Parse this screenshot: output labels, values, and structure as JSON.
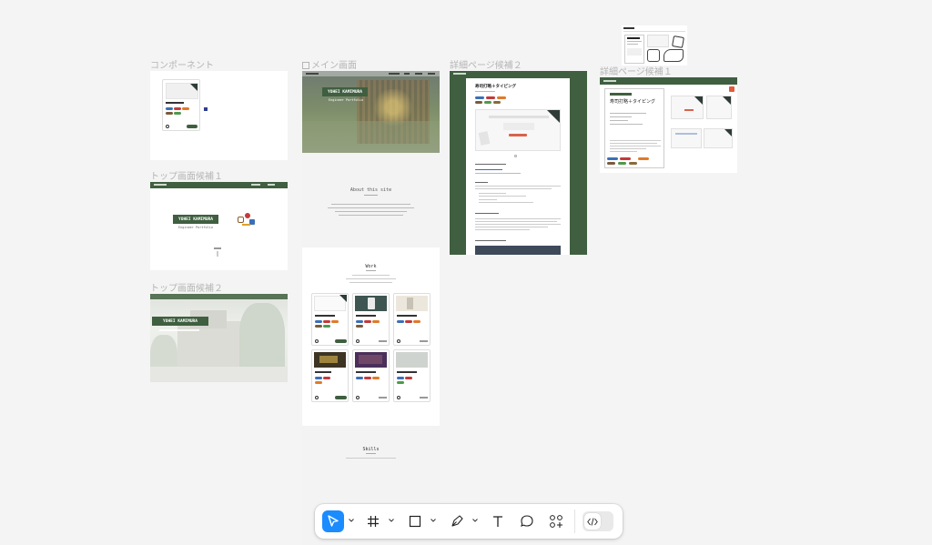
{
  "canvas": {
    "frames": {
      "components": {
        "label": "コンポーネント"
      },
      "top1": {
        "label": "トップ画面候補１",
        "hero_name": "YOHEI KAMIMURA",
        "hero_sub": "Engineer Portfolio"
      },
      "top2": {
        "label": "トップ画面候補２",
        "hero_name": "YOHEI KAMIMURA"
      },
      "main": {
        "label": "メイン画面",
        "hero_name": "YOHEI KAMIMURA",
        "hero_sub": "Engineer Portfolio",
        "about_title": "About this site",
        "work_title": "Work",
        "skills_title": "Skills"
      },
      "detail2": {
        "label": "詳細ページ候補２",
        "heading": "寿司打略＋タイピング"
      },
      "detail1": {
        "label": "詳細ページ候補１",
        "heading": "寿司打略＋タイピング"
      }
    }
  },
  "toolbar": {
    "tools": [
      {
        "name": "move",
        "icon": "cursor-arrow-icon",
        "active": true
      },
      {
        "name": "frame",
        "icon": "hash-frame-icon"
      },
      {
        "name": "shape",
        "icon": "rectangle-icon"
      },
      {
        "name": "pen",
        "icon": "pen-nib-icon"
      },
      {
        "name": "text",
        "icon": "text-T-icon"
      },
      {
        "name": "comment",
        "icon": "speech-bubble-icon"
      },
      {
        "name": "actions",
        "icon": "actions-grid-icon"
      },
      {
        "name": "dev-mode",
        "icon": "code-brackets-icon"
      }
    ]
  },
  "colors": {
    "accent": "#1a8cff",
    "brand_green": "#3f5f40",
    "canvas_bg": "#f4f4f4"
  }
}
